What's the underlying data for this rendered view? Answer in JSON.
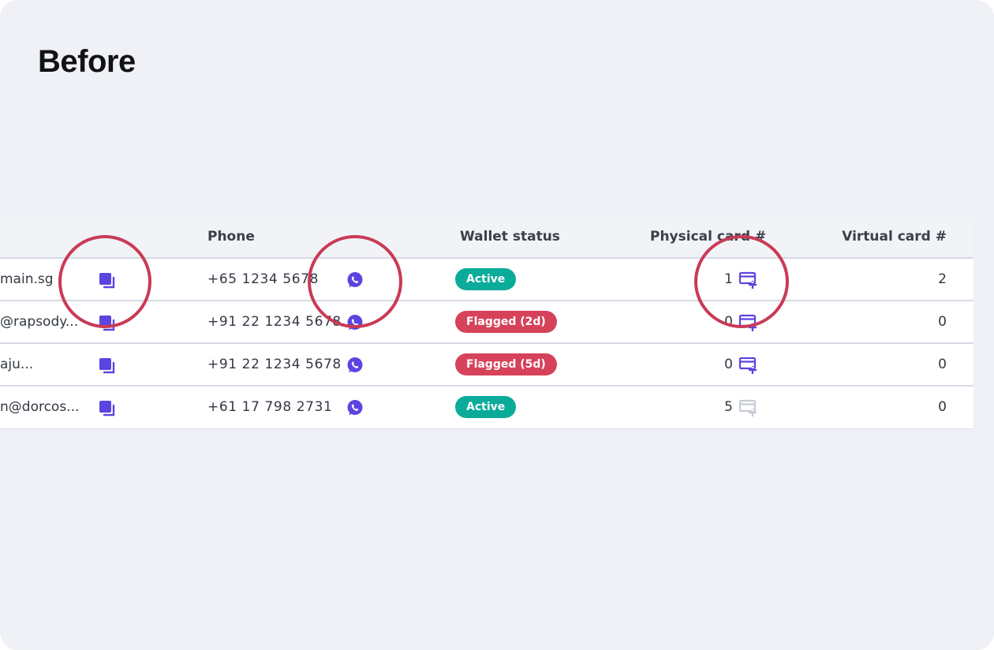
{
  "title": "Before",
  "table": {
    "headers": {
      "phone": "Phone",
      "wallet_status": "Wallet status",
      "physical_card": "Physical card #",
      "virtual_card": "Virtual card #"
    },
    "rows": [
      {
        "email": "main.sg",
        "phone": "+65 1234 5678",
        "status": "Active",
        "status_type": "active",
        "physical": "1",
        "physical_icon_state": "enabled",
        "virtual": "2"
      },
      {
        "email": "@rapsody...",
        "phone": "+91 22 1234 5678",
        "status": "Flagged (2d)",
        "status_type": "flagged",
        "physical": "0",
        "physical_icon_state": "enabled",
        "virtual": "0"
      },
      {
        "email": "aju...",
        "phone": "+91 22 1234 5678",
        "status": "Flagged (5d)",
        "status_type": "flagged",
        "physical": "0",
        "physical_icon_state": "enabled",
        "virtual": "0"
      },
      {
        "email": "n@dorcos...",
        "phone": "+61 17 798 2731",
        "status": "Active",
        "status_type": "active",
        "physical": "5",
        "physical_icon_state": "disabled",
        "virtual": "0"
      }
    ]
  },
  "icons": {
    "copy": "copy-icon",
    "whatsapp": "whatsapp-icon",
    "add_card": "add-card-icon"
  },
  "colors": {
    "accent": "#5b45e0",
    "active": "#0bab9a",
    "flagged": "#d6425a",
    "highlight_circle": "#c93a56",
    "disabled_icon": "#c8ccd6"
  }
}
